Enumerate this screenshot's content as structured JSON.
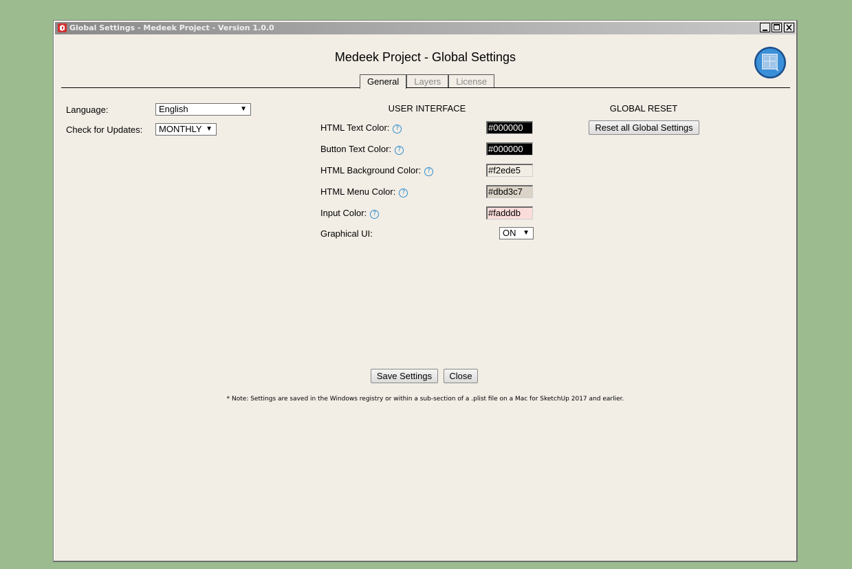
{
  "window": {
    "title": "Global Settings - Medeek Project - Version 1.0.0"
  },
  "header": {
    "title": "Medeek Project - Global Settings"
  },
  "tabs": [
    {
      "label": "General",
      "active": true
    },
    {
      "label": "Layers",
      "active": false
    },
    {
      "label": "License",
      "active": false
    }
  ],
  "general": {
    "language_label": "Language:",
    "language_value": "English",
    "updates_label": "Check for Updates:",
    "updates_value": "MONTHLY"
  },
  "user_interface": {
    "heading": "USER INTERFACE",
    "rows": [
      {
        "label": "HTML Text Color:",
        "value": "#000000",
        "bg": "#000000",
        "fg": "#ffffff"
      },
      {
        "label": "Button Text Color:",
        "value": "#000000",
        "bg": "#000000",
        "fg": "#ffffff"
      },
      {
        "label": "HTML Background Color:",
        "value": "#f2ede5",
        "bg": "#f2ede5",
        "fg": "#000000"
      },
      {
        "label": "HTML Menu Color:",
        "value": "#dbd3c7",
        "bg": "#dbd3c7",
        "fg": "#000000"
      },
      {
        "label": "Input Color:",
        "value": "#fadddb",
        "bg": "#fadddb",
        "fg": "#000000"
      }
    ],
    "graphical_label": "Graphical UI:",
    "graphical_value": "ON"
  },
  "global_reset": {
    "heading": "GLOBAL RESET",
    "button_label": "Reset all Global Settings"
  },
  "actions": {
    "save_label": "Save Settings",
    "close_label": "Close"
  },
  "note": "* Note: Settings are saved in the Windows registry or within a sub-section of a .plist file on a Mac for SketchUp 2017 and earlier.",
  "icons": {
    "app": "sketchup-icon",
    "help": "help-icon",
    "logo": "medeek-logo-icon"
  },
  "colors": {
    "desktop": "#9cbc8f",
    "window_bg": "#f2ede5",
    "accent_blue": "#2f8fd0"
  }
}
